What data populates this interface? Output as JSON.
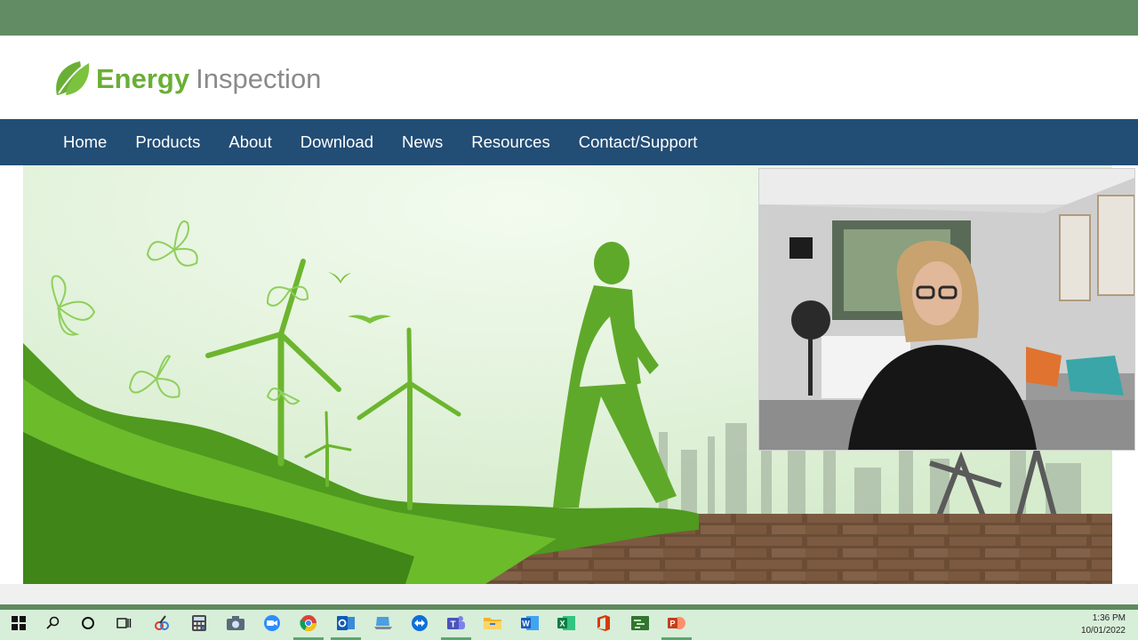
{
  "site": {
    "logo_word1": "Energy",
    "logo_word2": "Inspection",
    "brand_green": "#6aaf35",
    "nav_bg": "#224d75",
    "top_band": "#628c63"
  },
  "nav": {
    "items": [
      {
        "label": "Home"
      },
      {
        "label": "Products"
      },
      {
        "label": "About"
      },
      {
        "label": "Download"
      },
      {
        "label": "News"
      },
      {
        "label": "Resources"
      },
      {
        "label": "Contact/Support"
      }
    ]
  },
  "hero": {
    "theme": "green walking figure, wind turbines, butterflies, brick wall, industrial silhouette"
  },
  "webcam": {
    "content": "presenter video overlay"
  },
  "taskbar": {
    "icons": [
      "windows-start-icon",
      "search-icon",
      "cortana-icon",
      "task-view-icon",
      "snipping-tool-icon",
      "calculator-icon",
      "camera-icon",
      "zoom-icon",
      "chrome-icon",
      "outlook-icon",
      "laptop-icon",
      "teamviewer-icon",
      "teams-icon",
      "file-explorer-icon",
      "word-icon",
      "excel-icon",
      "office-icon",
      "project-icon",
      "powerpoint-icon"
    ],
    "time": "1:36 PM",
    "date": "10/01/2022"
  }
}
